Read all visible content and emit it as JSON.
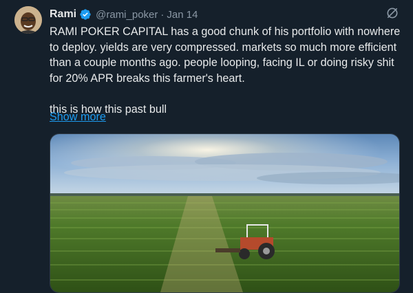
{
  "tweet": {
    "author_name": "Rami",
    "handle": "@rami_poker",
    "separator": "·",
    "date": "Jan 14",
    "text_para1": "RAMI POKER CAPITAL has a good chunk of his portfolio with nowhere to deploy. yields are very compressed. markets so much more efficient than a couple months ago. people looping, facing IL or doing risky shit for 20% APR breaks this farmer's heart.",
    "text_para2": "this is how this past bull",
    "show_more_label": "Show more"
  },
  "icons": {
    "verified": "verified-badge-icon",
    "more": "grok-slash-icon"
  },
  "colors": {
    "background": "#15202b",
    "text": "#e7e9ea",
    "muted": "#8b98a5",
    "link": "#1d9bf0"
  }
}
